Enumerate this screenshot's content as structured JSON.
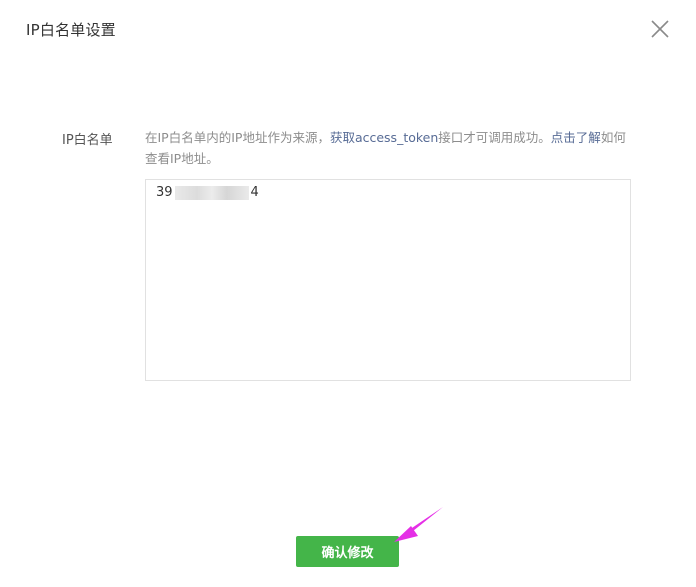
{
  "dialog": {
    "title": "IP白名单设置",
    "close_icon": "close-icon"
  },
  "whitelist": {
    "label": "IP白名单",
    "hint_prefix": "在IP白名单内的IP地址作为来源，",
    "hint_link_token": "获取access_token",
    "hint_middle": "接口才可调用成功。",
    "hint_link_help": "点击了解",
    "hint_suffix": "如何查看IP地址。",
    "ip_start": "39",
    "ip_end": "4"
  },
  "footer": {
    "confirm_label": "确认修改",
    "confirm_color": "#44b549"
  },
  "annotation": {
    "arrow_color": "#e52fe6",
    "arrow_icon": "arrow-icon"
  }
}
